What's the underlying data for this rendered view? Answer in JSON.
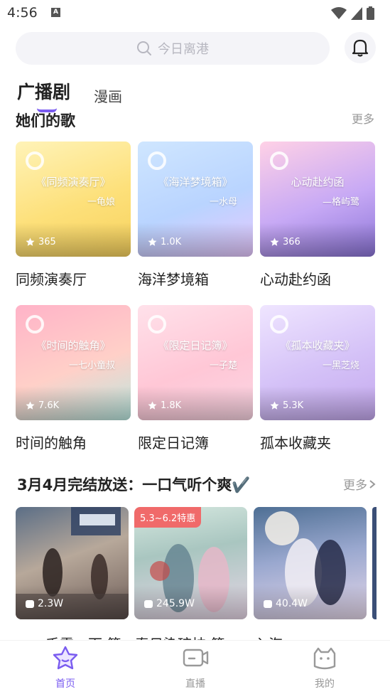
{
  "status": {
    "time": "4:56",
    "notif": "A"
  },
  "search": {
    "placeholder": "今日离港"
  },
  "tabs": {
    "active": "广播剧",
    "inactive": "漫画"
  },
  "section1": {
    "title": "她们的歌",
    "more": "更多"
  },
  "grid": [
    {
      "name": "同频演奏厅",
      "cover_title": "《同频演奏厅》",
      "cover_author": "一龟娘",
      "plays": "365",
      "colors": [
        "#fff3b8",
        "#fde07a",
        "#f7d25e"
      ]
    },
    {
      "name": "海洋梦境箱",
      "cover_title": "《海洋梦境箱》",
      "cover_author": "一水母",
      "plays": "1.0K",
      "colors": [
        "#cfe6ff",
        "#b9d4ff",
        "#e7c8ff"
      ]
    },
    {
      "name": "心动赴约函",
      "cover_title": "心动赴约函",
      "cover_author": "—格屿鹭",
      "plays": "366",
      "colors": [
        "#ffd1e6",
        "#c7a9f5",
        "#8c75d8"
      ]
    },
    {
      "name": "时间的触角",
      "cover_title": "《时间的触角》",
      "cover_author": "一七小童叔",
      "plays": "7.6K",
      "colors": [
        "#ffb3c8",
        "#ffd0c8",
        "#b9e8e0"
      ]
    },
    {
      "name": "限定日记簿",
      "cover_title": "《限定日记簿》",
      "cover_author": "一子楚",
      "plays": "1.8K",
      "colors": [
        "#ffe1ea",
        "#ffc7d6",
        "#fad5e3"
      ]
    },
    {
      "name": "孤本收藏夹",
      "cover_title": "《孤本收藏夹》",
      "cover_author": "一黑芝烧",
      "plays": "5.3K",
      "colors": [
        "#efe5ff",
        "#d4c1f7",
        "#c4a8ee"
      ]
    }
  ],
  "section2": {
    "title": "3月4月完结放送：一口气听个爽✔️",
    "more": "更多"
  },
  "wide_cards": [
    {
      "plays": "2.3W",
      "badge": "",
      "cut_name": "一千零一面 第"
    },
    {
      "plays": "245.9W",
      "badge": "5.3~6.2特惠",
      "cut_name": "春日染琼枝 第"
    },
    {
      "plays": "40.4W",
      "badge": "",
      "cut_name": "入海"
    }
  ],
  "nav": [
    {
      "label": "首页",
      "color": "#7a5cf0"
    },
    {
      "label": "直播",
      "color": "#999999"
    },
    {
      "label": "我的",
      "color": "#999999"
    }
  ],
  "colors": {
    "accent": "#7a5cf0",
    "promo": "#f06a6a"
  }
}
